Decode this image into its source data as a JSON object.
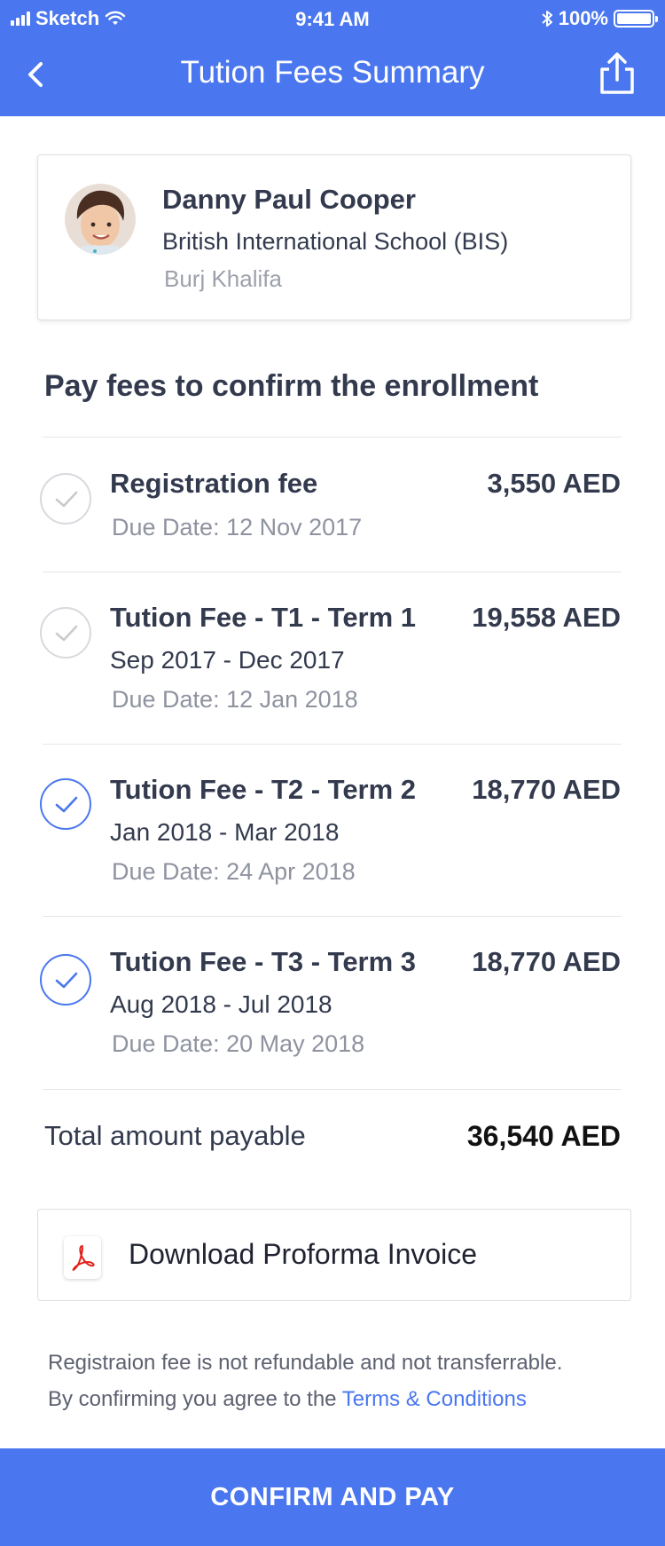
{
  "status_bar": {
    "carrier": "Sketch",
    "time": "9:41 AM",
    "battery": "100%"
  },
  "header": {
    "title": "Tution Fees Summary",
    "back_icon": "chevron-left-icon",
    "share_icon": "share-icon"
  },
  "student": {
    "name": "Danny Paul Cooper",
    "school": "British International School (BIS)",
    "location": "Burj Khalifa"
  },
  "section_title": "Pay fees to confirm the enrollment",
  "fees": [
    {
      "name": "Registration fee",
      "period": "",
      "due": "Due Date: 12 Nov 2017",
      "amount": "3,550 AED",
      "selected": false
    },
    {
      "name": "Tution Fee - T1 - Term 1",
      "period": "Sep 2017 - Dec 2017",
      "due": "Due Date: 12 Jan 2018",
      "amount": "19,558 AED",
      "selected": false
    },
    {
      "name": "Tution Fee - T2 - Term 2",
      "period": "Jan 2018 - Mar 2018",
      "due": "Due Date: 24 Apr 2018",
      "amount": "18,770 AED",
      "selected": true
    },
    {
      "name": "Tution Fee - T3 - Term 3",
      "period": "Aug 2018 - Jul 2018",
      "due": "Due Date: 20 May 2018",
      "amount": "18,770 AED",
      "selected": true
    }
  ],
  "total": {
    "label": "Total amount payable",
    "value": "36,540 AED"
  },
  "download": {
    "label": "Download Proforma Invoice",
    "icon": "pdf-icon"
  },
  "notes": {
    "line1": "Registraion fee is not refundable and not transferrable.",
    "line2_prefix": "By confirming you agree to the ",
    "terms_link": "Terms & Conditions"
  },
  "confirm_button": "CONFIRM AND PAY",
  "colors": {
    "primary": "#4a77ef",
    "text": "#333a4e",
    "muted": "#8f93a0",
    "pdf_red": "#e0201b"
  }
}
